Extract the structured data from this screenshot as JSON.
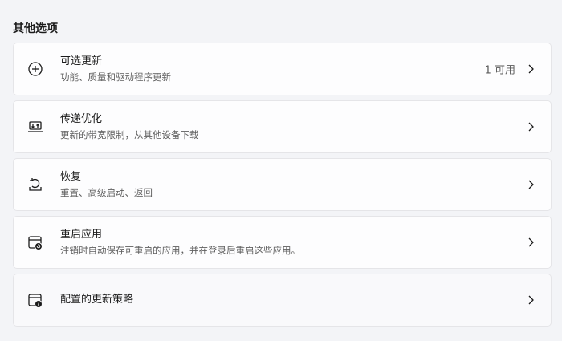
{
  "section": {
    "title": "其他选项"
  },
  "items": [
    {
      "title": "可选更新",
      "subtitle": "功能、质量和驱动程序更新",
      "value": "1 可用",
      "icon": "plus-circle-icon"
    },
    {
      "title": "传递优化",
      "subtitle": "更新的带宽限制，从其他设备下载",
      "icon": "delivery-optimization-icon"
    },
    {
      "title": "恢复",
      "subtitle": "重置、高级启动、返回",
      "icon": "recovery-icon"
    },
    {
      "title": "重启应用",
      "subtitle": "注销时自动保存可重启的应用，并在登录后重启这些应用。",
      "icon": "restart-apps-icon"
    },
    {
      "title": "配置的更新策略",
      "icon": "update-policy-icon"
    }
  ],
  "colors": {
    "background": "#f3f4f7",
    "card": "#fdfdfe",
    "border": "#e5e5e8",
    "secondary_text": "#5e5e5e"
  }
}
